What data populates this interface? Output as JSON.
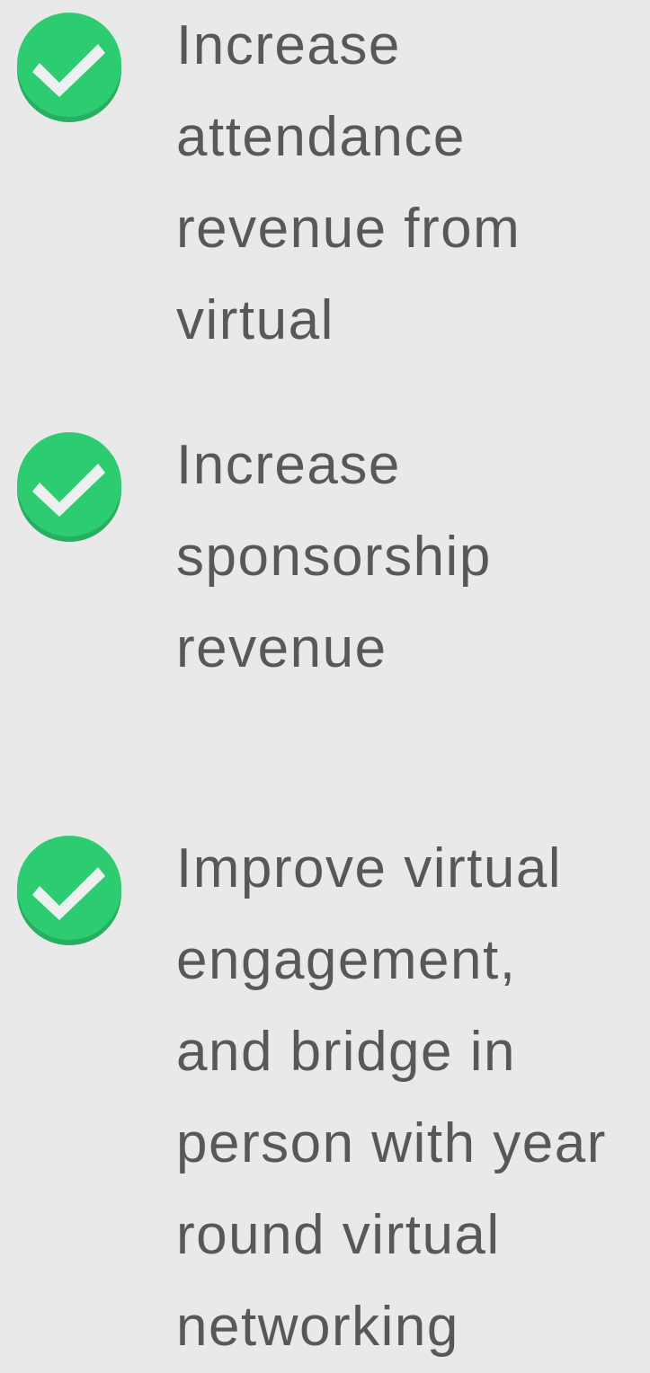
{
  "colors": {
    "background": "#e9e9e9",
    "check_circle": "#2ecc71",
    "check_circle_shadow": "#27ae60",
    "check_mark": "#ecf0f1",
    "text": "#585858"
  },
  "checklist": {
    "items": [
      {
        "icon": "check-circle-icon",
        "text": "Increase\nattendance\nrevenue from\nvirtual"
      },
      {
        "icon": "check-circle-icon",
        "text": "Increase\nsponsorship\nrevenue"
      },
      {
        "icon": "check-circle-icon",
        "text": "Improve virtual\nengagement,\nand bridge in\nperson with year\nround virtual\nnetworking"
      }
    ]
  }
}
